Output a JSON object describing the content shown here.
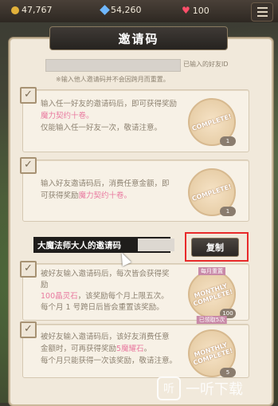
{
  "topbar": {
    "gold": "47,767",
    "gems": "54,260",
    "hearts": "100"
  },
  "panel": {
    "title": "邀请码",
    "id_label": "已输入的好友ID",
    "note": "※输入他人邀请码并不会因跨月而重置。"
  },
  "cards": [
    {
      "line1": "输入任一好友的邀请码后，即可获得奖励",
      "reward": "魔力契约十卷。",
      "line3": "仅能输入任一好友一次，敬请注意。",
      "stamp": "COMPLETE!",
      "count": "1"
    },
    {
      "line1": "输入好友邀请码后，消费任意金额，即",
      "line2_prefix": "可获得奖励",
      "reward": "魔力契约十卷。",
      "stamp": "COMPLETE!",
      "count": "1"
    },
    {
      "line1": "被好友输入邀请码后，每次皆会获得奖",
      "line2": "励",
      "reward_prefix": "100晶灵石",
      "line3_suffix": "，该奖励每个月上限五次。",
      "line4": "每个月 1 号跨日后皆会重置该奖励。",
      "stamp": "MONTHLY COMPLETE!",
      "count": "100",
      "banner_top": "每月重置",
      "banner_bottom": "已领取5次"
    },
    {
      "line1": "被好友输入邀请码后，该好友消费任意",
      "line2_prefix": "金额时，可再获得奖励",
      "reward": "5魔耀石",
      "line2_suffix": "。",
      "line3": "每个月只能获得一次该奖励，敬请注意。",
      "stamp": "MONTHLY COMPLETE!",
      "count": "5"
    }
  ],
  "invite": {
    "label": "大魔法师大人的邀请码",
    "copy_label": "复制"
  },
  "watermark": {
    "logo_char": "听",
    "text": "一听下载"
  },
  "colors": {
    "accent_pink": "#e97aa0",
    "highlight_red": "#e82a2a"
  }
}
